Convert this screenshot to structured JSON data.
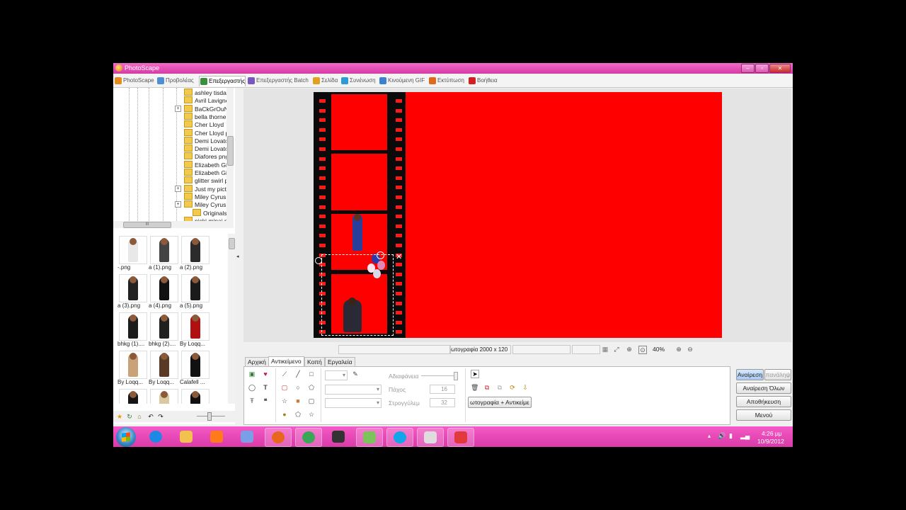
{
  "window": {
    "title": "PhotoScape",
    "controls": [
      "–",
      "▫",
      "✕"
    ]
  },
  "tabs": [
    {
      "label": "PhotoScape",
      "color": "#e58a1f"
    },
    {
      "label": "Προβολέας",
      "color": "#4d8ed6"
    },
    {
      "label": "Επεξεργαστής",
      "color": "#3b8f3b",
      "active": true
    },
    {
      "label": "Επεξεργαστής Batch",
      "color": "#7a56c2"
    },
    {
      "label": "Σελίδα",
      "color": "#e0a020"
    },
    {
      "label": "Συνένωση",
      "color": "#2f9ad6"
    },
    {
      "label": "Κινούμενη GIF",
      "color": "#3d7fd0"
    },
    {
      "label": "Εκτύπωση",
      "color": "#e06a1a"
    },
    {
      "label": "Βοήθεια",
      "color": "#d22020"
    }
  ],
  "tree": {
    "items": [
      {
        "label": "ashley tisdale",
        "expander": false
      },
      {
        "label": "Avril Lavigne",
        "expander": false
      },
      {
        "label": "BaCkGrOuNd",
        "expander": true
      },
      {
        "label": "bella thorne",
        "expander": false
      },
      {
        "label": "Cher Lloyd",
        "expander": false
      },
      {
        "label": "Cher Lloyd p",
        "expander": false
      },
      {
        "label": "Demi Lovato",
        "expander": false
      },
      {
        "label": "Demi Lovato",
        "expander": false
      },
      {
        "label": "Diafores png",
        "expander": false
      },
      {
        "label": "Elizabeth Gill",
        "expander": false
      },
      {
        "label": "Elizabeth Gill",
        "expander": false
      },
      {
        "label": "glitter swirl p",
        "expander": false
      },
      {
        "label": "Just my pict",
        "expander": true
      },
      {
        "label": "Miley Cyrus",
        "expander": false
      },
      {
        "label": "Miley Cyrus p",
        "expander": true
      },
      {
        "label": "Originals",
        "expander": false,
        "indent": true
      },
      {
        "label": "nicki minaj p",
        "expander": false
      }
    ],
    "hscroll_marker": "III"
  },
  "thumbnails": [
    {
      "caption": "-.png",
      "color": "#e8e8e8"
    },
    {
      "caption": "a (1).png",
      "color": "#444444"
    },
    {
      "caption": "a (2).png",
      "color": "#2b2b2b"
    },
    {
      "caption": "a (3).png",
      "color": "#222222"
    },
    {
      "caption": "a (4).png",
      "color": "#111111"
    },
    {
      "caption": "a (5).png",
      "color": "#1a1a1a"
    },
    {
      "caption": "bhkg (1)....",
      "color": "#1c1c1c"
    },
    {
      "caption": "bhkg (2)....",
      "color": "#202020"
    },
    {
      "caption": "By Loqq...",
      "color": "#b01010"
    },
    {
      "caption": "By Loqq...",
      "color": "#c9a27a"
    },
    {
      "caption": "By Loqq...",
      "color": "#5a3a24"
    },
    {
      "caption": "Calafell ...",
      "color": "#111111"
    },
    {
      "caption": "",
      "color": "#151515"
    },
    {
      "caption": "",
      "color": "#d9c9a0"
    },
    {
      "caption": "",
      "color": "#101010"
    }
  ],
  "left_tools": [
    "★",
    "↻",
    "⌂",
    "↶",
    "↷"
  ],
  "status": {
    "image_info": "ωτογραφία 2000 x 120",
    "zoom": "40%"
  },
  "bottom_tabs": [
    "Αρχική",
    "Αντικείμενο",
    "Κοπή",
    "Εργαλεία"
  ],
  "panel": {
    "transparency_label": "Αδιαφάνεια",
    "thickness_label": "Πάχος",
    "thickness_value": "16",
    "rounding_label": "Στρογγύλεμ",
    "rounding_value": "32",
    "merge_button": "ωτογραφία + Αντικείμε"
  },
  "right_buttons": {
    "undo": "Αναίρεση",
    "redo": "πανάληψ",
    "undo_all": "Αναίρεση Όλων",
    "save": "Αποθήκευση",
    "menu": "Μενού"
  },
  "taskbar": {
    "items": [
      {
        "name": "ie",
        "color": "#1e88e5",
        "open": false
      },
      {
        "name": "explorer",
        "color": "#f2c14e",
        "open": false
      },
      {
        "name": "media-player",
        "color": "#ff7a1a",
        "open": false
      },
      {
        "name": "paint",
        "color": "#7a9ee8",
        "open": false
      },
      {
        "name": "firefox",
        "color": "#e8671c",
        "open": true
      },
      {
        "name": "chrome",
        "color": "#3aa757",
        "open": true
      },
      {
        "name": "camera",
        "color": "#333333",
        "open": false
      },
      {
        "name": "messenger",
        "color": "#7cc35a",
        "open": true
      },
      {
        "name": "skype",
        "color": "#12a5e8",
        "open": true
      },
      {
        "name": "window",
        "color": "#dddddd",
        "open": true
      },
      {
        "name": "photoscape",
        "color": "#e23a3a",
        "open": true
      }
    ],
    "clock_time": "4:26 μμ",
    "clock_date": "10/9/2012"
  }
}
